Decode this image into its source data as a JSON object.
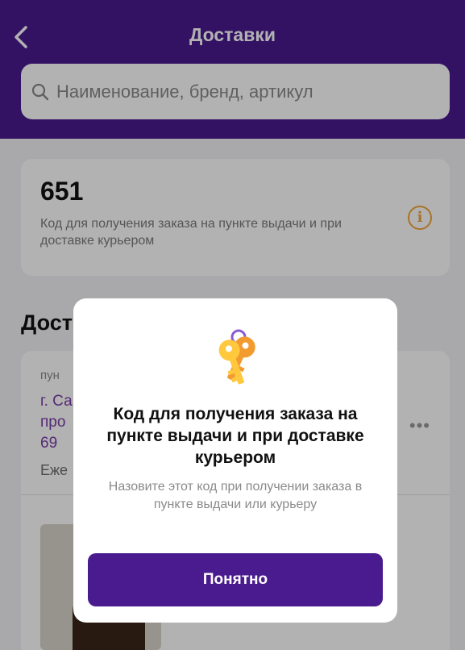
{
  "header": {
    "title": "Доставки",
    "back_icon": "chevron-left-icon"
  },
  "search": {
    "placeholder": "Наименование, бренд, артикул",
    "icon": "search-icon"
  },
  "code_card": {
    "code": "651",
    "description": "Код для получения заказа на пункте выдачи и при доставке курьером",
    "icon": "info-icon"
  },
  "deliveries": {
    "section_title": "Дост",
    "card": {
      "pickup_label": "пун",
      "address": "г. Са\nпро\n69",
      "schedule": "Еже",
      "more_icon": "more-horizontal-icon"
    }
  },
  "modal": {
    "icon": "keys-icon",
    "title": "Код для получения заказа на пункте выдачи и при доставке курьером",
    "text": "Назовите этот код при получении заказа в пункте выдачи или курьеру",
    "button_label": "Понятно"
  },
  "colors": {
    "brand": "#4a1b8f",
    "accent_orange": "#f2a53b",
    "address_purple": "#7a3aa8"
  }
}
